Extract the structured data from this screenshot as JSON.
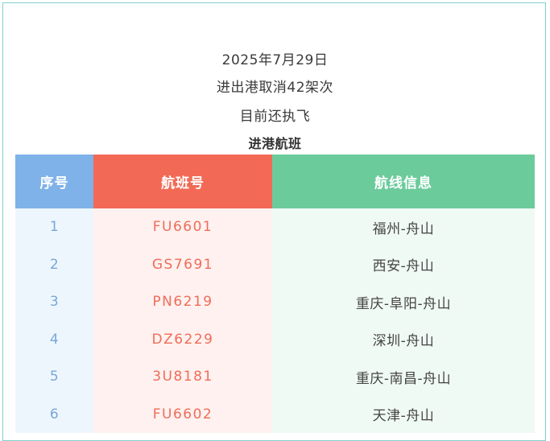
{
  "header": {
    "date": "2025年7月29日",
    "cancel_text": "进出港取消42架次",
    "status_text": "目前还执飞",
    "section_title": "进港航班"
  },
  "table": {
    "columns": [
      "序号",
      "航班号",
      "航线信息"
    ],
    "rows": [
      {
        "seq": "1",
        "flight": "FU6601",
        "route": "福州-舟山"
      },
      {
        "seq": "2",
        "flight": "GS7691",
        "route": "西安-舟山"
      },
      {
        "seq": "3",
        "flight": "PN6219",
        "route": "重庆-阜阳-舟山"
      },
      {
        "seq": "4",
        "flight": "DZ6229",
        "route": "深圳-舟山"
      },
      {
        "seq": "5",
        "flight": "3U8181",
        "route": "重庆-南昌-舟山"
      },
      {
        "seq": "6",
        "flight": "FU6602",
        "route": "天津-舟山"
      }
    ]
  },
  "colors": {
    "frame_border": "#7fd1cc",
    "seq_header": "#7fb2e8",
    "flight_header": "#f26a55",
    "route_header": "#6ccb9b"
  }
}
